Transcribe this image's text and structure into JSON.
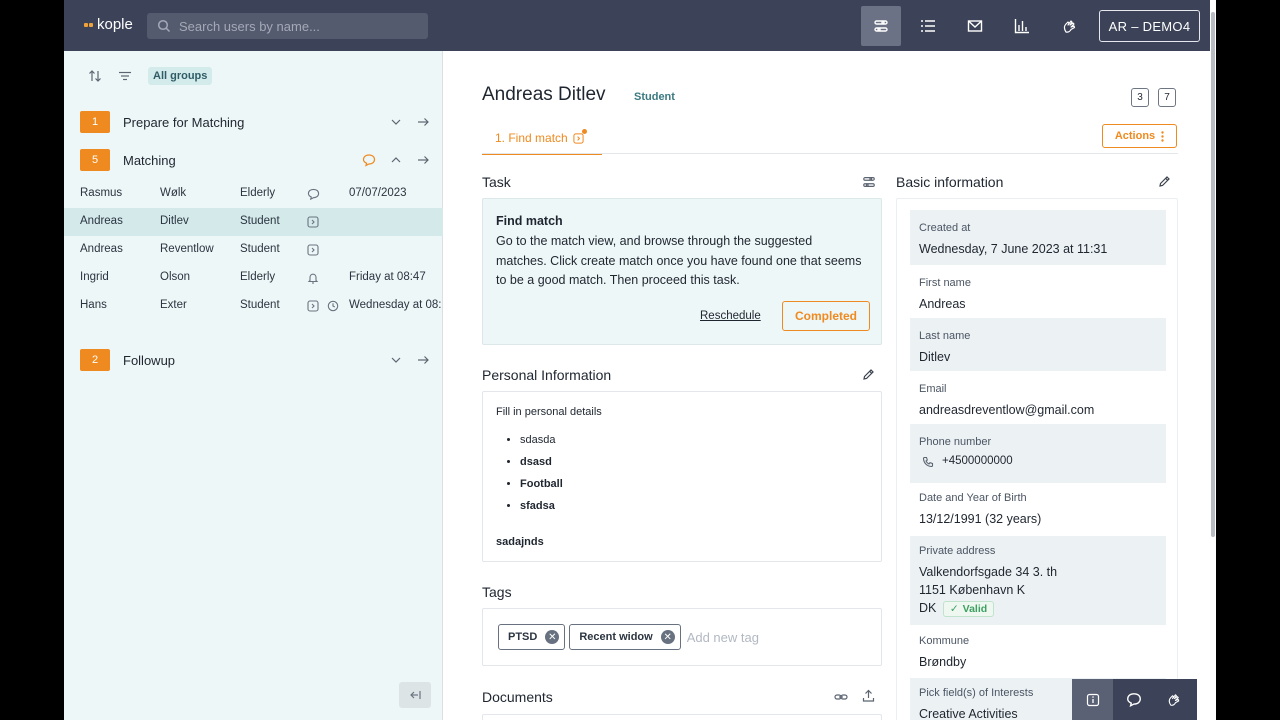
{
  "topbar": {
    "logo": "kople",
    "search_placeholder": "Search users by name...",
    "user": "AR – DEMO4",
    "nav_icons": [
      "tasks-icon",
      "list-icon",
      "mail-icon",
      "chart-icon",
      "hand-icon"
    ]
  },
  "left": {
    "filter_chip": "All groups",
    "groups": [
      {
        "num": "1",
        "label": "Prepare for Matching"
      },
      {
        "num": "5",
        "label": "Matching"
      },
      {
        "num": "2",
        "label": "Followup"
      }
    ],
    "users": [
      {
        "first": "Rasmus",
        "last": "Wølk",
        "role": "Elderly",
        "date": "07/07/2023"
      },
      {
        "first": "Andreas",
        "last": "Ditlev",
        "role": "Student",
        "date": ""
      },
      {
        "first": "Andreas",
        "last": "Reventlow",
        "role": "Student",
        "date": ""
      },
      {
        "first": "Ingrid",
        "last": "Olson",
        "role": "Elderly",
        "date": "Friday at 08:47"
      },
      {
        "first": "Hans",
        "last": "Exter",
        "role": "Student",
        "date": "Wednesday at 08:"
      }
    ]
  },
  "main": {
    "name": "Andreas Ditlev",
    "role": "Student",
    "count_a": "3",
    "count_b": "7",
    "tab_label": "1.  Find match",
    "actions": "Actions",
    "task_heading": "Task",
    "task_title": "Find match",
    "task_desc": "Go to the match view, and browse through the suggested matches. Click create match once you have found one that seems to be a good match. Then proceed this task.",
    "reschedule": "Reschedule",
    "completed": "Completed",
    "pi_heading": "Personal Information",
    "pi_intro": "Fill in personal details",
    "pi_items": [
      "sdasda",
      "dsasd",
      "Football",
      "sfadsa"
    ],
    "pi_tail": "sadajnds",
    "tags_heading": "Tags",
    "tags": [
      "PTSD",
      "Recent widow"
    ],
    "tag_placeholder": "Add new tag",
    "documents_heading": "Documents"
  },
  "basic_info": {
    "heading": "Basic information",
    "created_label": "Created at",
    "created_value": "Wednesday, 7 June 2023 at 11:31",
    "first_label": "First name",
    "first_value": "Andreas",
    "last_label": "Last name",
    "last_value": "Ditlev",
    "email_label": "Email",
    "email_value": "andreasdreventlow@gmail.com",
    "phone_label": "Phone number",
    "phone_value": "+4500000000",
    "dob_label": "Date and Year of Birth",
    "dob_value": "13/12/1991 (32 years)",
    "address_label": "Private address",
    "address_line1": "Valkendorfsgade 34 3. th",
    "address_line2": "1151 København K",
    "address_line3": "DK",
    "valid": "Valid",
    "kommune_label": "Kommune",
    "kommune_value": "Brøndby",
    "interests_label": "Pick field(s) of Interests",
    "interests_value": "Creative Activities"
  },
  "colors": {
    "accent": "#ee8a1f",
    "topbar": "#3c4257",
    "panel": "#eef7f8",
    "teal": "#3b7a80"
  }
}
